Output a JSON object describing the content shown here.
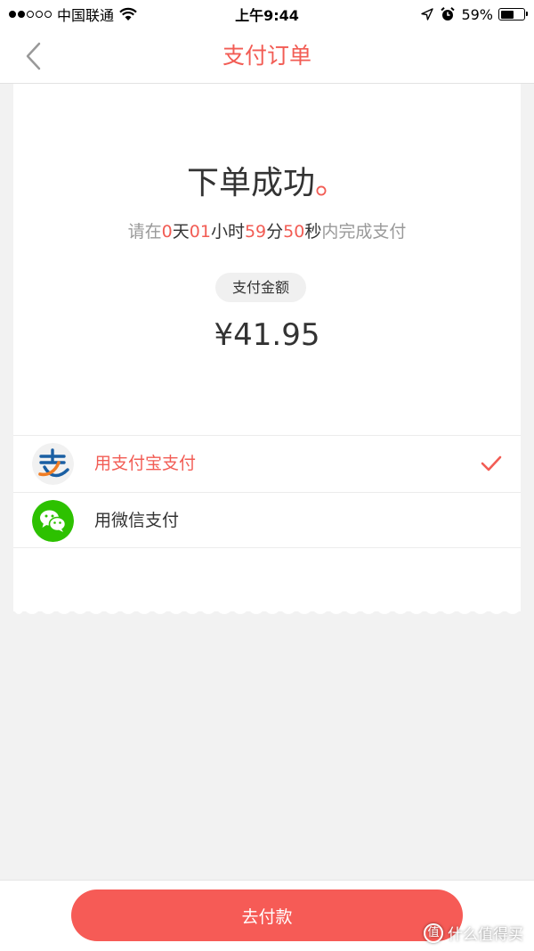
{
  "status_bar": {
    "carrier": "中国联通",
    "time": "上午9:44",
    "battery_percent": "59%",
    "battery_level": 0.59,
    "signal_bars_filled": 2,
    "signal_bars_total": 5
  },
  "nav": {
    "title": "支付订单"
  },
  "order": {
    "success_text": "下单成功",
    "success_mark": "。",
    "countdown": {
      "prefix": "请在",
      "days": "0",
      "days_unit": "天",
      "hours": "01",
      "hours_unit": "小时",
      "minutes": "59",
      "minutes_unit": "分",
      "seconds": "50",
      "seconds_unit": "秒",
      "suffix": "内完成支付"
    },
    "amount_label": "支付金额",
    "amount": "¥41.95"
  },
  "payment_methods": [
    {
      "label": "用支付宝支付",
      "icon": "alipay-icon",
      "selected": true
    },
    {
      "label": "用微信支付",
      "icon": "wechat-icon",
      "selected": false
    }
  ],
  "bottom": {
    "pay_button_label": "去付款",
    "watermark_text": "什么值得买",
    "watermark_badge": "值"
  },
  "colors": {
    "accent": "#f25c54",
    "button": "#f65b56",
    "alipay_blue": "#1a5fa3",
    "wechat_green": "#2dc100",
    "background": "#f2f2f2"
  }
}
